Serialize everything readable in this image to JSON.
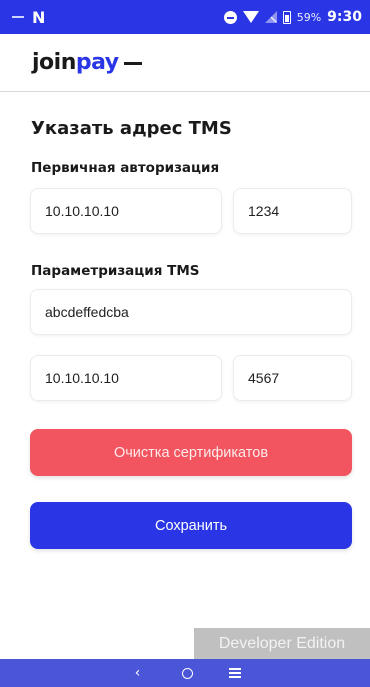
{
  "status_bar": {
    "battery_percent": "59%",
    "time": "9:30",
    "icons": [
      "dash-icon",
      "n-notification-icon",
      "do-not-disturb-icon",
      "wifi-icon",
      "no-signal-icon",
      "battery-icon"
    ]
  },
  "app": {
    "logo_part1": "join",
    "logo_part2": "pay"
  },
  "page": {
    "title": "Указать адрес TMS"
  },
  "primary_auth": {
    "label": "Первичная авторизация",
    "host": "10.10.10.10",
    "port": "1234"
  },
  "tms_param": {
    "label": "Параметризация TMS",
    "id": "abcdeffedcba",
    "host": "10.10.10.10",
    "port": "4567"
  },
  "buttons": {
    "clear_certificates": "Очистка сертификатов",
    "save": "Сохранить"
  },
  "watermark": "Developer Edition",
  "colors": {
    "brand_blue": "#2a36e6",
    "danger_red": "#f2555f"
  }
}
